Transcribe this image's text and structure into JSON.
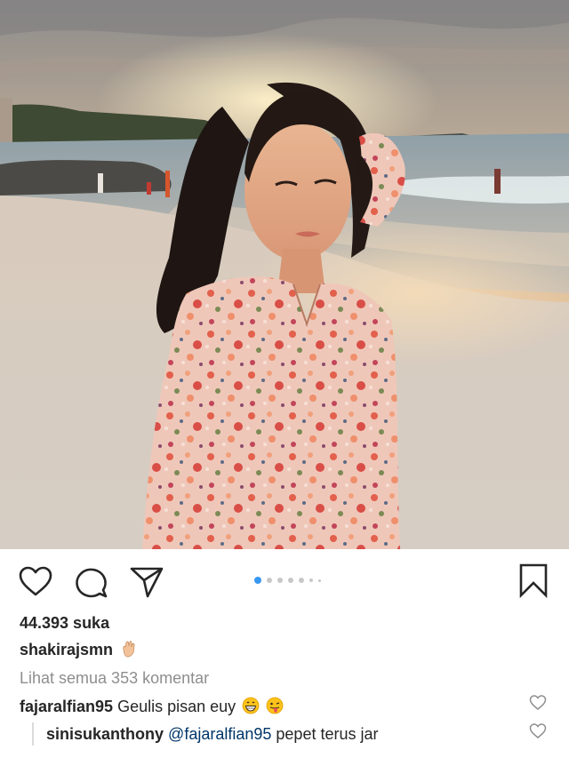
{
  "post": {
    "photo_name": "beach-sunset-photo",
    "carousel": {
      "total": 7,
      "current": 1
    },
    "likes_text": "44.393 suka",
    "caption_user": "shakirajsmn",
    "caption_emoji": "waving-hand-emoji",
    "view_all_comments": "Lihat semua 353 komentar",
    "comments": [
      {
        "user": "fajaralfian95",
        "text": "Geulis  pisan euy",
        "emojis": [
          "grinning-emoji",
          "tongue-out-emoji"
        ]
      },
      {
        "user": "sinisukanthony",
        "mention": "@fajaralfian95",
        "text": "pepet terus jar",
        "reply": true
      }
    ]
  },
  "icons": {
    "like": "heart-icon",
    "comment": "comment-bubble-icon",
    "share": "paper-plane-icon",
    "save": "bookmark-icon"
  },
  "colors": {
    "text": "#262626",
    "muted": "#8e8e8e",
    "mention": "#003569",
    "carousel_active": "#3897f0",
    "carousel_inactive": "#c7c7c7"
  }
}
